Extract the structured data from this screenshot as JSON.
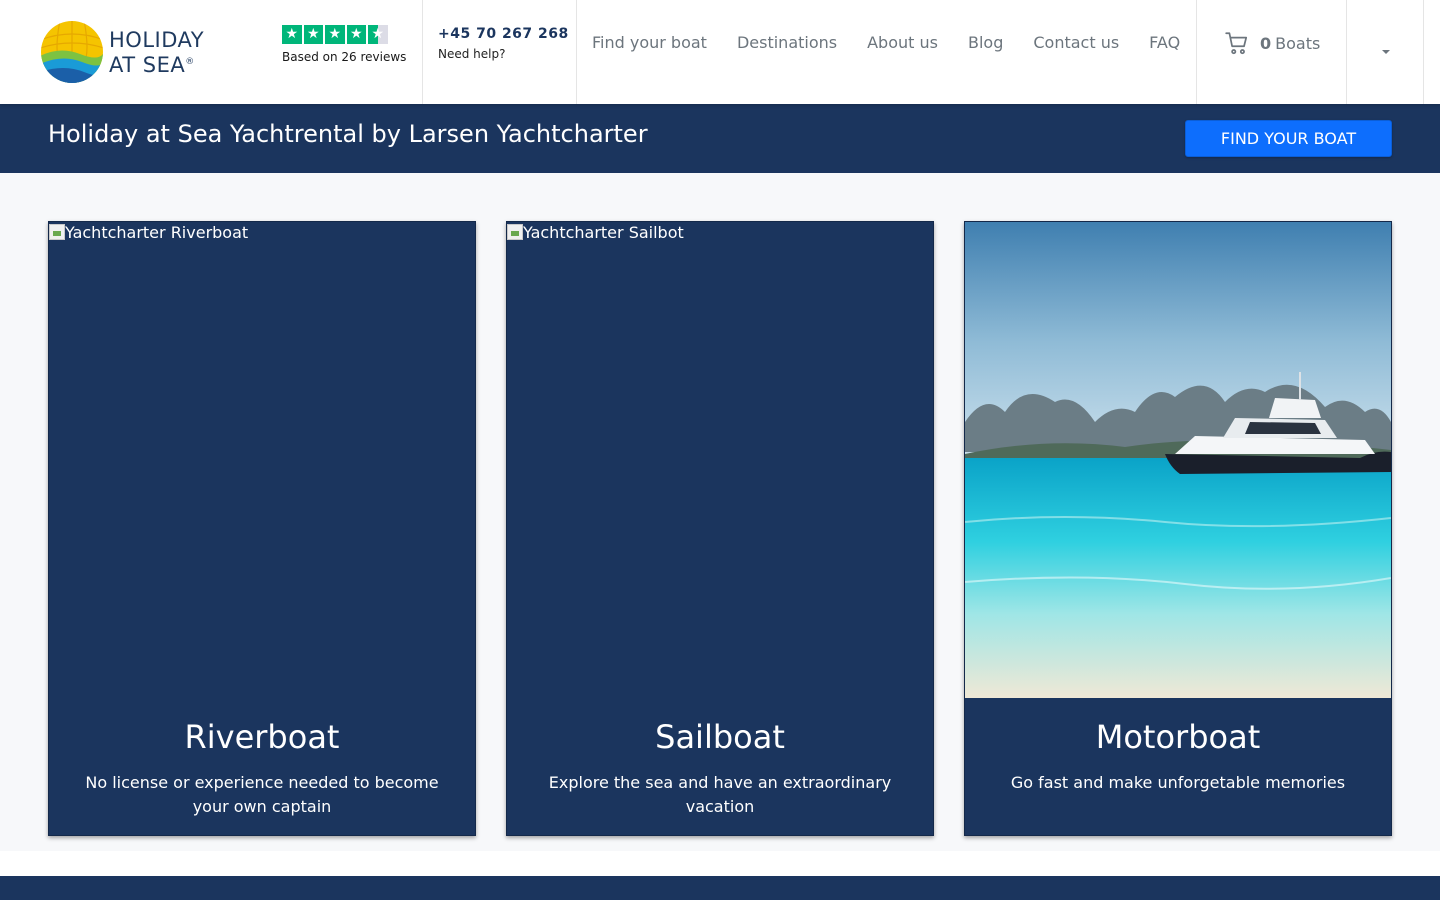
{
  "brand": {
    "logo_line1": "HOLIDAY",
    "logo_line2": "AT SEA",
    "logo_mark": "®"
  },
  "trustpilot": {
    "stars": 4.5,
    "reviews_text": "Based on 26 reviews"
  },
  "contact": {
    "phone": "+45 70 267 268",
    "help": "Need help?"
  },
  "nav": {
    "items": [
      "Find your boat",
      "Destinations",
      "About us",
      "Blog",
      "Contact us",
      "FAQ"
    ]
  },
  "cart": {
    "count": "0",
    "label": "Boats"
  },
  "hero": {
    "title": "Holiday at Sea Yachtrental by Larsen Yachtcharter",
    "button": "FIND YOUR BOAT"
  },
  "cards": [
    {
      "alt": "Yachtcharter Riverboat",
      "title": "Riverboat",
      "text": "No license or experience needed to become your own captain"
    },
    {
      "alt": "Yachtcharter Sailbot",
      "title": "Sailboat",
      "text": "Explore the sea and have an extraordinary vacation"
    },
    {
      "alt": "Yachtcharter Motorboat",
      "title": "Motorboat",
      "text": "Go fast and make unforgetable memories"
    }
  ],
  "colors": {
    "navy": "#1b355e",
    "primary_button": "#0d6efd",
    "trustpilot_green": "#00b67a",
    "nav_text": "#6c757d"
  }
}
